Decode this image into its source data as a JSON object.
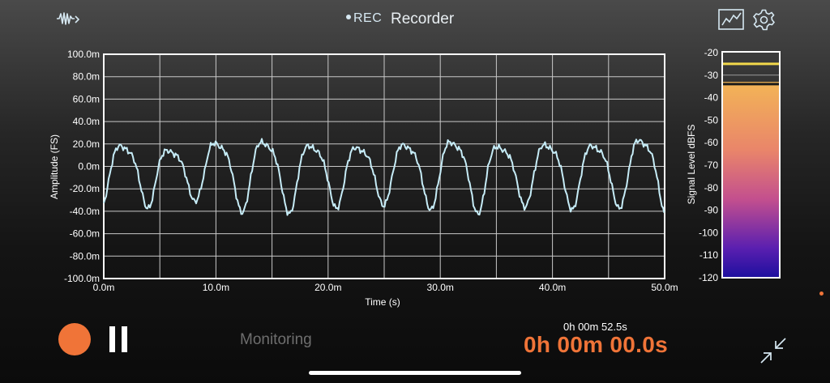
{
  "header": {
    "rec_label": "REC",
    "title": "Recorder",
    "icons": [
      "waveform-icon",
      "chart-view-icon",
      "gear-icon"
    ]
  },
  "waveform_panel": {
    "y_axis_label": "Amplitude (FS)",
    "x_axis_label": "Time (s)",
    "y_ticks": [
      "100.0m",
      "80.0m",
      "60.0m",
      "40.0m",
      "20.0m",
      "0.0m",
      "-20.0m",
      "-40.0m",
      "-60.0m",
      "-80.0m",
      "-100.0m"
    ],
    "x_ticks": [
      "0.0m",
      "10.0m",
      "20.0m",
      "30.0m",
      "40.0m",
      "50.0m"
    ]
  },
  "level_meter": {
    "axis_label": "Signal Level dBFS",
    "ticks": [
      "-20",
      "-30",
      "-40",
      "-50",
      "-60",
      "-70",
      "-80",
      "-90",
      "-100",
      "-110",
      "-120"
    ],
    "range": [
      -120,
      -20
    ],
    "current_level_dbfs": -33,
    "peak_marker_dbfs": -25,
    "hold_marker_dbfs": -34,
    "colors": {
      "top": "#f3b556",
      "mid": "#c34f8e",
      "bottom": "#1d0f9e",
      "peak": "#f2d84b"
    }
  },
  "controls": {
    "status": "Monitoring",
    "elapsed": "0h 00m 52.5s",
    "timer": "0h 00m 00.0s"
  },
  "colors": {
    "accent": "#f07438",
    "trace": "#c6ecf7",
    "grid": "#c8c8c8"
  }
}
